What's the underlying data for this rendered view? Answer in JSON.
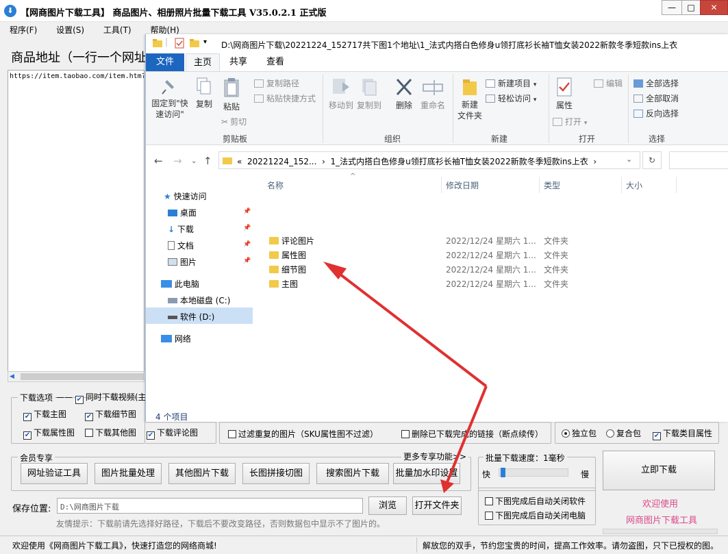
{
  "window": {
    "title": "【网商图片下载工具】 商品图片、相册照片批量下载工具 V35.0.2.1 正式版",
    "minimize": "—",
    "maximize": "□",
    "close": "✕"
  },
  "menu": [
    "程序(F)",
    "设置(S)",
    "工具(T)",
    "帮助(H)"
  ],
  "left_panel": {
    "address_label": "商品地址（一行一个网址",
    "url_text": "https://item.taobao.com/item.htm?"
  },
  "explorer": {
    "title_path": "D:\\网商图片下载\\20221224_152717共下图1个地址\\1_法式内搭白色修身u领打底衫长袖T恤女装2022新款冬季短款ins上衣",
    "tabs": [
      "文件",
      "主页",
      "共享",
      "查看"
    ],
    "ribbon": {
      "clipboard": {
        "pin": "固定到\"快速访问\"",
        "copy": "复制",
        "paste": "粘贴",
        "copy_path": "复制路径",
        "paste_shortcut": "粘贴快捷方式",
        "cut": "剪切",
        "label": "剪贴板"
      },
      "organize": {
        "move_to": "移动到",
        "copy_to": "复制到",
        "delete": "删除",
        "rename": "重命名",
        "label": "组织"
      },
      "new": {
        "new_folder": "新建\n文件夹",
        "new_item": "新建项目",
        "easy_access": "轻松访问",
        "label": "新建"
      },
      "open": {
        "properties": "属性",
        "open": "打开",
        "edit": "编辑",
        "label": "打开"
      },
      "select": {
        "select_all": "全部选择",
        "select_none": "全部取消",
        "invert": "反向选择",
        "label": "选择"
      }
    },
    "address": {
      "prefix": "«",
      "seg1": "20221224_152...",
      "seg2": "1_法式内搭白色修身u领打底衫长袖T恤女装2022新款冬季短款ins上衣"
    },
    "nav_pane": {
      "quick_access": "快速访问",
      "desktop": "桌面",
      "downloads": "下载",
      "documents": "文档",
      "pictures": "图片",
      "this_pc": "此电脑",
      "local_c": "本地磁盘 (C:)",
      "soft_d": "软件 (D:)",
      "network": "网络"
    },
    "columns": [
      "名称",
      "修改日期",
      "类型",
      "大小"
    ],
    "files": [
      {
        "name": "评论图片",
        "date": "2022/12/24 星期六 1...",
        "type": "文件夹"
      },
      {
        "name": "属性图",
        "date": "2022/12/24 星期六 1...",
        "type": "文件夹"
      },
      {
        "name": "细节图",
        "date": "2022/12/24 星期六 1...",
        "type": "文件夹"
      },
      {
        "name": "主图",
        "date": "2022/12/24 星期六 1...",
        "type": "文件夹"
      }
    ],
    "status": "4 个项目"
  },
  "download_options": {
    "title": "下载选项",
    "video": "同时下载视频(主",
    "main": "下载主图",
    "detail": "下载细节图",
    "attr": "下载属性图",
    "other": "下载其他图",
    "comment": "下载评论图"
  },
  "filter": {
    "dup": "过滤重复的图片（SKU属性图不过滤）",
    "resume": "删除已下载完成的链接（断点续传）"
  },
  "pack": {
    "single": "独立包",
    "combined": "复合包",
    "category": "下载类目属性"
  },
  "member": {
    "title": "会员专享",
    "more": "更多专享功能>>",
    "buttons": [
      "网址验证工具",
      "图片批量处理",
      "其他图片下载",
      "长图拼接切图",
      "搜索图片下载",
      "批量加水印设置"
    ]
  },
  "speed": {
    "title": "批量下载速度：1毫秒",
    "fast": "快",
    "slow": "慢",
    "speed_level": 0.02
  },
  "auto_close": {
    "software": "下图完成后自动关闭软件",
    "computer": "下图完成后自动关闭电脑"
  },
  "start": {
    "label": "立即下载",
    "welcome1": "欢迎使用",
    "welcome2": "网商图片下载工具"
  },
  "save": {
    "label": "保存位置:",
    "path": "D:\\网商图片下载",
    "browse": "浏览",
    "open_folder": "打开文件夹",
    "hint": "友情提示：下载前请先选择好路径，下载后不要改变路径，否则数据包中显示不了图片的。"
  },
  "status_bar": {
    "left": "欢迎使用《网商图片下载工具》，快速打造您的网络商城!",
    "right": "解放您的双手，节约您宝贵的时间，提高工作效率。请勿盗图，只下已授权的图。"
  },
  "colors": {
    "accent": "#1d66c0",
    "arrow": "#e03030",
    "welcome": "#d94b8a"
  }
}
